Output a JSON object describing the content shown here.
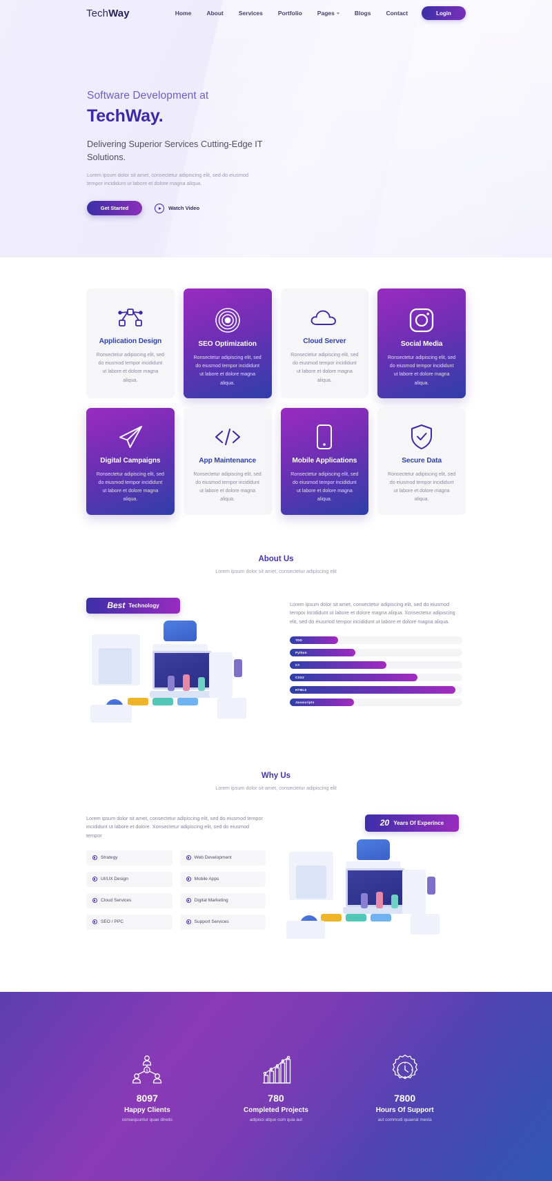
{
  "header": {
    "logo_prefix": "Tech",
    "logo_suffix": "Way",
    "nav": [
      {
        "label": "Home",
        "caret": false
      },
      {
        "label": "About",
        "caret": false
      },
      {
        "label": "Services",
        "caret": false
      },
      {
        "label": "Portfolio",
        "caret": false
      },
      {
        "label": "Pages",
        "caret": true
      },
      {
        "label": "Blogs",
        "caret": false
      },
      {
        "label": "Contact",
        "caret": false
      }
    ],
    "login_label": "Login"
  },
  "hero": {
    "pre_title": "Software Development at",
    "title": "TechWay.",
    "subtitle": "Delivering Superior Services Cutting-Edge IT Solutions.",
    "paragraph": "Lorem ipsum dolor sit amet, consectetur adipiscing elit, sed do eiusmod tempor incididunt ut labore et dolore magna aliqua.",
    "primary_button": "Get Started",
    "video_button": "Watch Video"
  },
  "services": {
    "body_text": "Ronsectetur adipiscing elit, sed do eiusmod tempor incididunt ut labore et dolore magna aliqua.",
    "cards": [
      {
        "title": "Application Design",
        "icon": "nodes-icon",
        "active": false
      },
      {
        "title": "SEO Optimization",
        "icon": "target-icon",
        "active": true
      },
      {
        "title": "Cloud Server",
        "icon": "cloud-icon",
        "active": false
      },
      {
        "title": "Social Media",
        "icon": "instagram-icon",
        "active": true
      },
      {
        "title": "Digital Campaigns",
        "icon": "paper-plane-icon",
        "active": true
      },
      {
        "title": "App Maintenance",
        "icon": "code-icon",
        "active": false
      },
      {
        "title": "Mobile Applications",
        "icon": "mobile-icon",
        "active": true
      },
      {
        "title": "Secure Data",
        "icon": "shield-check-icon",
        "active": false
      }
    ]
  },
  "about": {
    "title": "About Us",
    "subtitle": "Lorem ipsum dolor sit amet, consectetur adipiscing elit",
    "badge_big": "Best",
    "badge_small": "Technology",
    "paragraph": "Lorem ipsum dolor sit amet, consectetur adipiscing elit, sed do eiusmod tempor incididunt ut labore et dolore magna aliqua. Xonsectetur adipiscing elit, sed do eiusmod tempor incididunt ut labore et dolore magna aliqua.",
    "skills": [
      {
        "label": "TDD",
        "percent": 28
      },
      {
        "label": "Python",
        "percent": 38
      },
      {
        "label": "C#",
        "percent": 56
      },
      {
        "label": "CSS3",
        "percent": 74
      },
      {
        "label": "HTML5",
        "percent": 96
      },
      {
        "label": "Javascripts",
        "percent": 37
      }
    ]
  },
  "whyus": {
    "title": "Why Us",
    "subtitle": "Lorem ipsum dolor sit amet, consectetur adipiscing elit",
    "paragraph": "Lorem ipsum dolor sit amet, consectetur adipiscing elit, sed do eiusmod tempor incididunt ut labore et dolore. Xonsectetur adipiscing elit, sed do eiusmod tempor",
    "badge_big": "20",
    "badge_small": "Years Of Experince",
    "items": [
      "Strategy",
      "Web Development",
      "UI/UX Design",
      "Mobile Apps",
      "Cloud Services",
      "Digital Marketing",
      "SEO / PPC",
      "Support Services"
    ]
  },
  "stats": [
    {
      "number": "8097",
      "label": "Happy Clients",
      "sub": "consequuntur quae diredo",
      "icon": "team-network-icon"
    },
    {
      "number": "780",
      "label": "Completed Projects",
      "sub": "adipisci atque cum quia aut",
      "icon": "bar-chart-icon"
    },
    {
      "number": "7800",
      "label": "Hours Of Support",
      "sub": "aut commodi quaerat mesta",
      "icon": "gear-clock-icon"
    }
  ],
  "colors": {
    "brand_purple": "#4334b4",
    "brand_indigo": "#3b29a8",
    "accent_magenta": "#9a2bc0"
  }
}
